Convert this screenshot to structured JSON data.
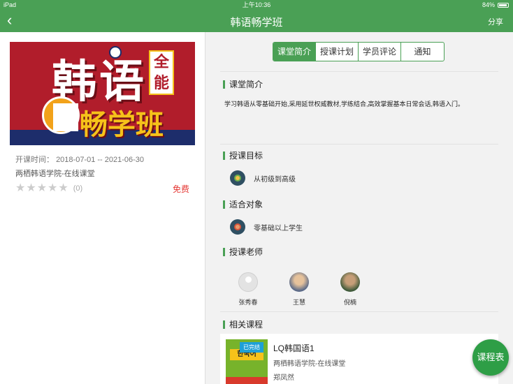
{
  "status": {
    "device": "iPad",
    "time": "上午10:36",
    "battery": "84%"
  },
  "nav": {
    "title": "韩语畅学班",
    "share": "分享"
  },
  "course_card": {
    "banner_text_main": "韩语",
    "banner_text_sub": "畅学班",
    "banner_badge": "全能",
    "date_label": "开课时间：",
    "date_range": "2018-07-01 -- 2021-06-30",
    "school": "两栖韩语学院-在线课堂",
    "rating": 0,
    "rating_count": "(0)",
    "price": "免费"
  },
  "tabs": [
    {
      "label": "课堂简介",
      "active": true
    },
    {
      "label": "授课计划",
      "active": false
    },
    {
      "label": "学员评论",
      "active": false
    },
    {
      "label": "通知",
      "active": false
    }
  ],
  "sections": {
    "intro": {
      "title": "课堂简介",
      "text": "学习韩语从零基础开始,采用延世权威教材,学练结合,高效掌握基本日常会话,韩语入门。"
    },
    "goal": {
      "title": "授课目标",
      "text": "从初级到高级"
    },
    "audience": {
      "title": "适合对象",
      "text": "零基础以上学生"
    },
    "teachers": {
      "title": "授课老师",
      "names": [
        "张秀春",
        "王慧",
        "倪楠"
      ]
    },
    "related": {
      "title": "相关课程"
    }
  },
  "related_course": {
    "status": "已完结",
    "title": "LQ韩国语1",
    "school": "两栖韩语学院-在线课堂",
    "teacher": "郑凤然",
    "thumb_text": "한국어"
  },
  "fab": {
    "label": "课程表"
  },
  "colors": {
    "primary": "#4aa055",
    "price": "#e53935",
    "badge": "#1ea0d6"
  }
}
